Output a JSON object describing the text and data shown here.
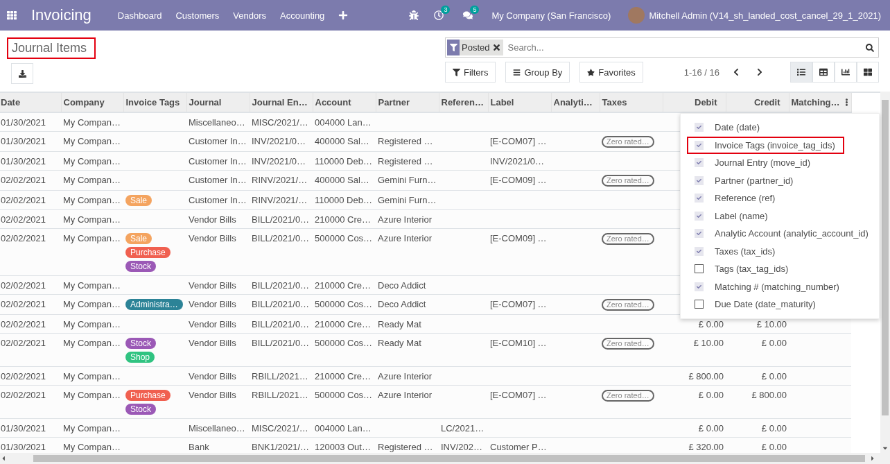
{
  "navbar": {
    "app_title": "Invoicing",
    "menu": [
      "Dashboard",
      "Customers",
      "Vendors",
      "Accounting"
    ],
    "activity_count": "3",
    "message_count": "5",
    "company": "My Company (San Francisco)",
    "user": "Mitchell Admin (V14_sh_landed_cost_cancel_29_1_2021)"
  },
  "control_panel": {
    "title": "Journal Items",
    "title_highlighted": true,
    "search": {
      "facets": [
        "Posted"
      ],
      "placeholder": "Search..."
    },
    "buttons": [
      {
        "kind": "filter",
        "label": "Filters"
      },
      {
        "kind": "group",
        "label": "Group By"
      },
      {
        "kind": "favorite",
        "label": "Favorites"
      }
    ],
    "pager": "1-16 / 16",
    "views": [
      {
        "kind": "list",
        "selected": true
      },
      {
        "kind": "pivot",
        "selected": false
      },
      {
        "kind": "graph",
        "selected": false
      },
      {
        "kind": "kanban",
        "selected": false
      }
    ]
  },
  "table": {
    "columns": [
      {
        "label": "Date",
        "kind": "text"
      },
      {
        "label": "Company",
        "kind": "text"
      },
      {
        "label": "Invoice Tags",
        "kind": "tags"
      },
      {
        "label": "Journal",
        "kind": "text"
      },
      {
        "label": "Journal En…",
        "kind": "text"
      },
      {
        "label": "Account",
        "kind": "text"
      },
      {
        "label": "Partner",
        "kind": "text"
      },
      {
        "label": "Referen…",
        "kind": "text"
      },
      {
        "label": "Label",
        "kind": "text"
      },
      {
        "label": "Analyti…",
        "kind": "text"
      },
      {
        "label": "Taxes",
        "kind": "pill"
      },
      {
        "label": "Debit",
        "kind": "amount"
      },
      {
        "label": "Credit",
        "kind": "amount"
      },
      {
        "label": "Matching…",
        "kind": "text"
      }
    ],
    "rows": [
      {
        "date": "01/30/2021",
        "company": "My Compan…",
        "journal": "Miscellaneo…",
        "entry": "MISC/2021/…",
        "account": "004000 Lan…"
      },
      {
        "date": "01/30/2021",
        "company": "My Compan…",
        "journal": "Customer In…",
        "entry": "INV/2021/0…",
        "account": "400000 Sal…",
        "partner": "Registered …",
        "label": "[E-COM07] …",
        "taxes": "Zero rated…"
      },
      {
        "date": "01/30/2021",
        "company": "My Compan…",
        "journal": "Customer In…",
        "entry": "INV/2021/0…",
        "account": "110000 Deb…",
        "partner": "Registered …",
        "label": "INV/2021/0…"
      },
      {
        "date": "02/02/2021",
        "company": "My Compan…",
        "journal": "Customer In…",
        "entry": "RINV/2021/…",
        "account": "400000 Sal…",
        "partner": "Gemini Furn…",
        "label": "[E-COM09] …",
        "taxes": "Zero rated…"
      },
      {
        "date": "02/02/2021",
        "company": "My Compan…",
        "tags": [
          {
            "label": "Sale",
            "color": "#f4a460"
          }
        ],
        "journal": "Customer In…",
        "entry": "RINV/2021/…",
        "account": "110000 Deb…",
        "partner": "Gemini Furn…"
      },
      {
        "date": "02/02/2021",
        "company": "My Compan…",
        "journal": "Vendor Bills",
        "entry": "BILL/2021/0…",
        "account": "210000 Cre…",
        "partner": "Azure Interior"
      },
      {
        "date": "02/02/2021",
        "company": "My Compan…",
        "tags": [
          {
            "label": "Sale",
            "color": "#f4a460"
          },
          {
            "label": "Purchase",
            "color": "#f06050"
          },
          {
            "label": "Stock",
            "color": "#9b59b6"
          }
        ],
        "journal": "Vendor Bills",
        "entry": "BILL/2021/0…",
        "account": "500000 Cos…",
        "partner": "Azure Interior",
        "label": "[E-COM09] …",
        "taxes": "Zero rated…"
      },
      {
        "date": "02/02/2021",
        "company": "My Compan…",
        "journal": "Vendor Bills",
        "entry": "BILL/2021/0…",
        "account": "210000 Cre…",
        "partner": "Deco Addict"
      },
      {
        "date": "02/02/2021",
        "company": "My Compan…",
        "tags": [
          {
            "label": "Administra…",
            "color": "#2c8397"
          }
        ],
        "journal": "Vendor Bills",
        "entry": "BILL/2021/0…",
        "account": "500000 Cos…",
        "partner": "Deco Addict",
        "label": "[E-COM07] …",
        "taxes": "Zero rated…"
      },
      {
        "date": "02/02/2021",
        "company": "My Compan…",
        "journal": "Vendor Bills",
        "entry": "BILL/2021/0…",
        "account": "210000 Cre…",
        "partner": "Ready Mat",
        "debit": "£ 0.00",
        "credit": "£ 10.00"
      },
      {
        "date": "02/02/2021",
        "company": "My Compan…",
        "tags": [
          {
            "label": "Stock",
            "color": "#9b59b6"
          },
          {
            "label": "Shop",
            "color": "#30c381"
          }
        ],
        "journal": "Vendor Bills",
        "entry": "BILL/2021/0…",
        "account": "500000 Cos…",
        "partner": "Ready Mat",
        "label": "[E-COM10] …",
        "taxes": "Zero rated…",
        "debit": "£ 10.00",
        "credit": "£ 0.00"
      },
      {
        "date": "02/02/2021",
        "company": "My Compan…",
        "journal": "Vendor Bills",
        "entry": "RBILL/2021…",
        "account": "210000 Cre…",
        "partner": "Azure Interior",
        "debit": "£ 800.00",
        "credit": "£ 0.00"
      },
      {
        "date": "02/02/2021",
        "company": "My Compan…",
        "tags": [
          {
            "label": "Purchase",
            "color": "#f06050"
          },
          {
            "label": "Stock",
            "color": "#9b59b6"
          }
        ],
        "journal": "Vendor Bills",
        "entry": "RBILL/2021…",
        "account": "500000 Cos…",
        "partner": "Azure Interior",
        "label": "[E-COM07] …",
        "taxes": "Zero rated…",
        "debit": "£ 0.00",
        "credit": "£ 800.00"
      },
      {
        "date": "01/30/2021",
        "company": "My Compan…",
        "journal": "Miscellaneo…",
        "entry": "MISC/2021/…",
        "account": "004000 Lan…",
        "reference": "LC/2021…",
        "debit": "£ 0.00",
        "credit": "£ 0.00"
      },
      {
        "date": "01/30/2021",
        "company": "My Compan…",
        "journal": "Bank",
        "entry": "BNK1/2021/…",
        "account": "120003 Out…",
        "partner": "Registered …",
        "reference": "INV/202…",
        "label": "Customer P…",
        "debit": "£ 320.00",
        "credit": "£ 0.00"
      }
    ]
  },
  "optional_columns": [
    {
      "label": "Date (date)",
      "checked": true,
      "highlighted": false
    },
    {
      "label": "Invoice Tags (invoice_tag_ids)",
      "checked": true,
      "highlighted": true
    },
    {
      "label": "Journal Entry (move_id)",
      "checked": true,
      "highlighted": false
    },
    {
      "label": "Partner (partner_id)",
      "checked": true,
      "highlighted": false
    },
    {
      "label": "Reference (ref)",
      "checked": true,
      "highlighted": false
    },
    {
      "label": "Label (name)",
      "checked": true,
      "highlighted": false
    },
    {
      "label": "Analytic Account (analytic_account_id)",
      "checked": true,
      "highlighted": false
    },
    {
      "label": "Taxes (tax_ids)",
      "checked": true,
      "highlighted": false
    },
    {
      "label": "Tags (tax_tag_ids)",
      "checked": false,
      "highlighted": false
    },
    {
      "label": "Matching # (matching_number)",
      "checked": true,
      "highlighted": false
    },
    {
      "label": "Due Date (date_maturity)",
      "checked": false,
      "highlighted": false
    }
  ]
}
